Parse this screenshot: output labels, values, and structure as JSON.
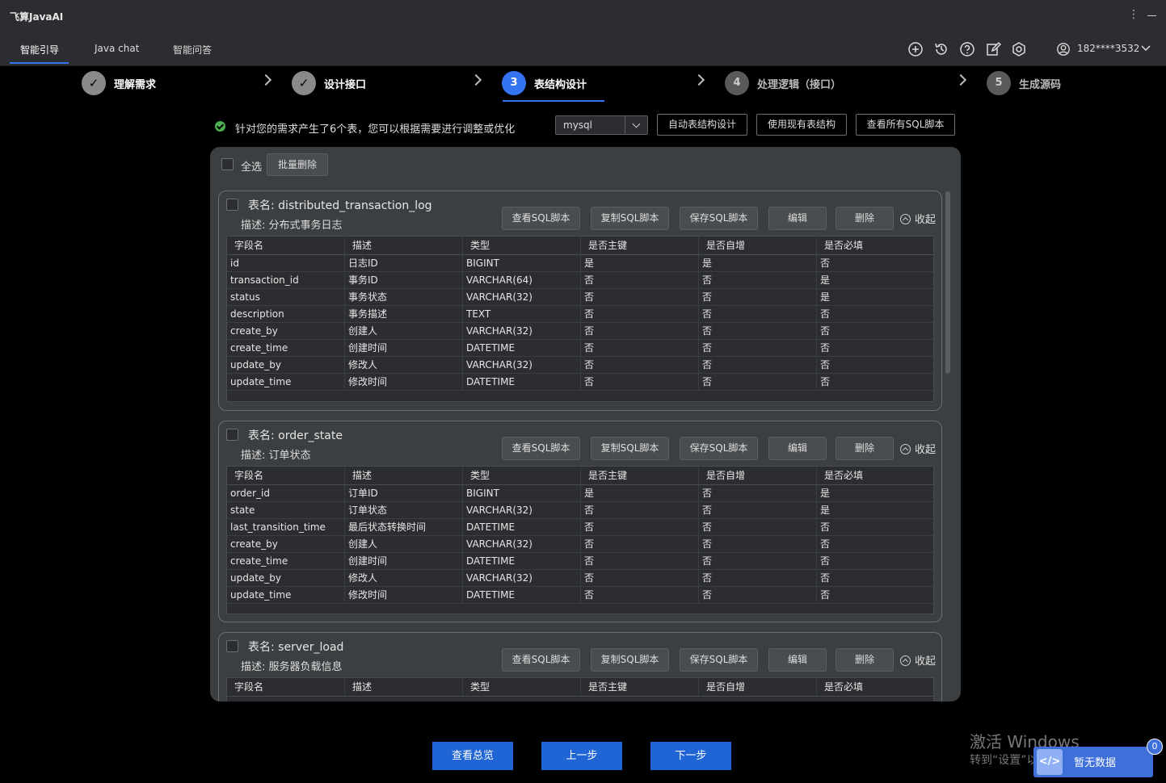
{
  "app": {
    "title": "飞算JavaAI"
  },
  "tabs": [
    {
      "label": "智能引导"
    },
    {
      "label": "Java chat"
    },
    {
      "label": "智能问答"
    }
  ],
  "header": {
    "icons": [
      "plus-circle-icon",
      "history-icon",
      "help-icon",
      "edit-icon",
      "settings-icon"
    ],
    "user": "182****3532"
  },
  "steps": [
    {
      "label": "理解需求",
      "mark": "✓",
      "state": "done"
    },
    {
      "label": "设计接口",
      "mark": "✓",
      "state": "done"
    },
    {
      "label": "表结构设计",
      "mark": "3",
      "state": "current"
    },
    {
      "label": "处理逻辑（接口）",
      "mark": "4",
      "state": "future"
    },
    {
      "label": "生成源码",
      "mark": "5",
      "state": "future"
    }
  ],
  "toolbar": {
    "notice": "针对您的需求产生了6个表，您可以根据需要进行调整或优化",
    "db_select": "mysql",
    "auto_design": "自动表结构设计",
    "use_existing": "使用现有表结构",
    "view_all_sql": "查看所有SQL脚本"
  },
  "panel": {
    "select_all": "全选",
    "batch_delete": "批量删除"
  },
  "card_buttons": {
    "view_sql": "查看SQL脚本",
    "copy_sql": "复制SQL脚本",
    "save_sql": "保存SQL脚本",
    "edit": "编辑",
    "delete": "删除",
    "collapse": "收起"
  },
  "columns": [
    "字段名",
    "描述",
    "类型",
    "是否主键",
    "是否自增",
    "是否必填"
  ],
  "tables": [
    {
      "name": "表名: distributed_transaction_log",
      "desc": "描述: 分布式事务日志",
      "rows": [
        [
          "id",
          "日志ID",
          "BIGINT",
          "是",
          "是",
          "否"
        ],
        [
          "transaction_id",
          "事务ID",
          "VARCHAR(64)",
          "否",
          "否",
          "是"
        ],
        [
          "status",
          "事务状态",
          "VARCHAR(32)",
          "否",
          "否",
          "是"
        ],
        [
          "description",
          "事务描述",
          "TEXT",
          "否",
          "否",
          "否"
        ],
        [
          "create_by",
          "创建人",
          "VARCHAR(32)",
          "否",
          "否",
          "否"
        ],
        [
          "create_time",
          "创建时间",
          "DATETIME",
          "否",
          "否",
          "否"
        ],
        [
          "update_by",
          "修改人",
          "VARCHAR(32)",
          "否",
          "否",
          "否"
        ],
        [
          "update_time",
          "修改时间",
          "DATETIME",
          "否",
          "否",
          "否"
        ]
      ]
    },
    {
      "name": "表名: order_state",
      "desc": "描述: 订单状态",
      "rows": [
        [
          "order_id",
          "订单ID",
          "BIGINT",
          "是",
          "否",
          "是"
        ],
        [
          "state",
          "订单状态",
          "VARCHAR(32)",
          "否",
          "否",
          "是"
        ],
        [
          "last_transition_time",
          "最后状态转换时间",
          "DATETIME",
          "否",
          "否",
          "否"
        ],
        [
          "create_by",
          "创建人",
          "VARCHAR(32)",
          "否",
          "否",
          "否"
        ],
        [
          "create_time",
          "创建时间",
          "DATETIME",
          "否",
          "否",
          "否"
        ],
        [
          "update_by",
          "修改人",
          "VARCHAR(32)",
          "否",
          "否",
          "否"
        ],
        [
          "update_time",
          "修改时间",
          "DATETIME",
          "否",
          "否",
          "否"
        ]
      ]
    },
    {
      "name": "表名: server_load",
      "desc": "描述: 服务器负载信息",
      "rows": []
    }
  ],
  "footer": {
    "overview": "查看总览",
    "prev": "上一步",
    "next": "下一步"
  },
  "watermark": {
    "line1": "激活 Windows",
    "line2": "转到“设置”以激活 Windows。"
  },
  "float_widget": {
    "label": "暂无数据",
    "badge": "0"
  }
}
